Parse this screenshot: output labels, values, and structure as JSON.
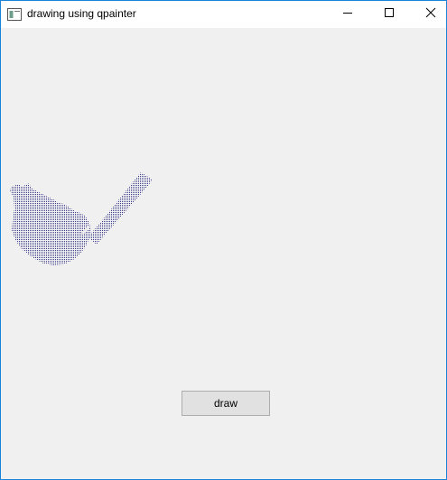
{
  "window": {
    "title": "drawing using qpainter",
    "app_icon": "qt-app-icon",
    "controls": {
      "minimize_icon": "minimize-icon",
      "maximize_icon": "maximize-icon",
      "close_icon": "close-icon"
    }
  },
  "canvas": {
    "stroke_color": "#3a3a8c",
    "background": "#f0f0f0"
  },
  "buttons": {
    "draw_label": "draw"
  },
  "colors": {
    "window_border": "#1883d7",
    "button_face": "#e1e1e1",
    "button_border": "#adadad"
  }
}
